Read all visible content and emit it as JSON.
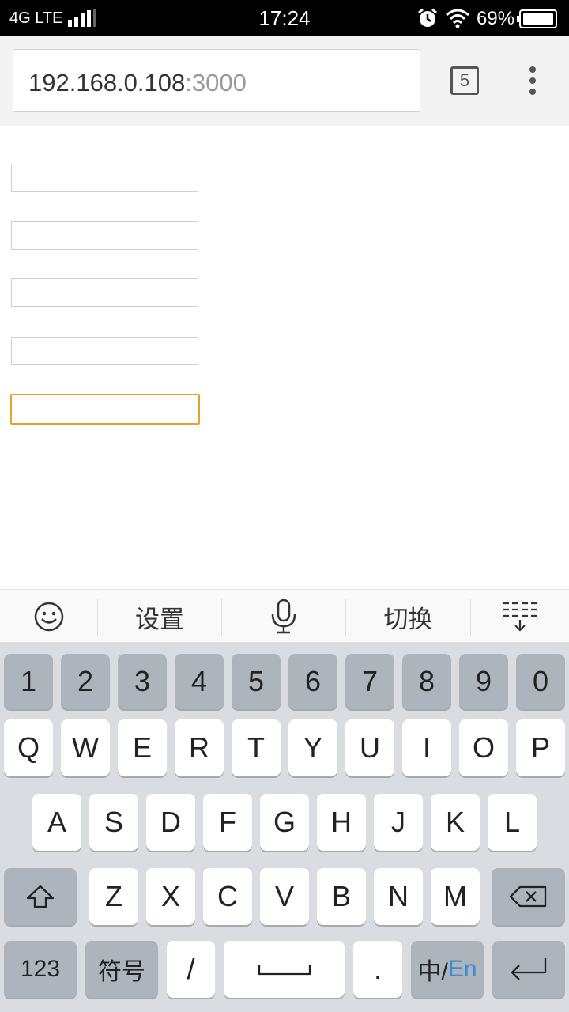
{
  "status_bar": {
    "network": "4G LTE",
    "time": "17:24",
    "battery_percent": "69%"
  },
  "browser": {
    "url_host": "192.168.0.108",
    "url_port": ":3000",
    "tab_count": "5"
  },
  "form": {
    "fields": [
      {
        "value": "",
        "focused": false
      },
      {
        "value": "",
        "focused": false
      },
      {
        "value": "",
        "focused": false
      },
      {
        "value": "",
        "focused": false
      },
      {
        "value": "",
        "focused": true
      }
    ],
    "focus_color": "#e5a32b"
  },
  "keyboard": {
    "toolbar": {
      "settings_label": "设置",
      "switch_label": "切换"
    },
    "number_row": [
      "1",
      "2",
      "3",
      "4",
      "5",
      "6",
      "7",
      "8",
      "9",
      "0"
    ],
    "row1": [
      "Q",
      "W",
      "E",
      "R",
      "T",
      "Y",
      "U",
      "I",
      "O",
      "P"
    ],
    "row2": [
      "A",
      "S",
      "D",
      "F",
      "G",
      "H",
      "J",
      "K",
      "L"
    ],
    "row3": [
      "Z",
      "X",
      "C",
      "V",
      "B",
      "N",
      "M"
    ],
    "bottom": {
      "num_label": "123",
      "symbol_label": "符号",
      "slash_label": "/",
      "period_label": ".",
      "lang_zh": "中/",
      "lang_en": "En"
    },
    "accent_color": "#3b8ad9"
  }
}
